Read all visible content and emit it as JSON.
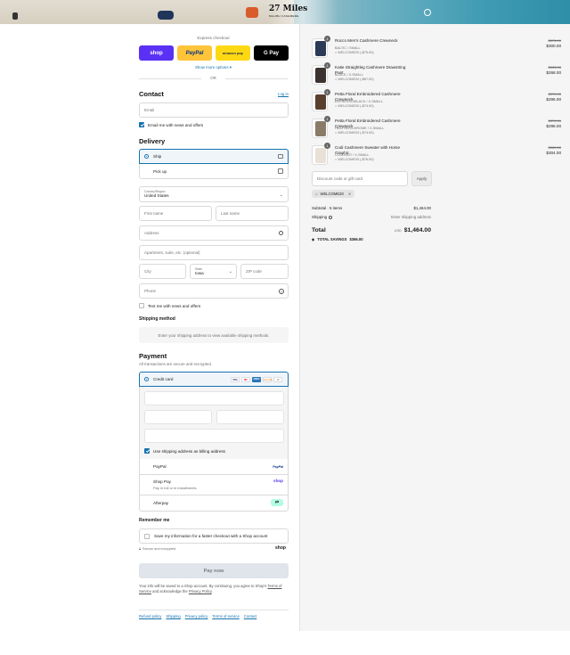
{
  "banner": {
    "brand_name": "27 Miles",
    "brand_tagline": "MALIBU CASHMERE"
  },
  "express": {
    "heading": "Express checkout",
    "shop_label": "shop",
    "paypal_label": "PayPal",
    "amazon_label": "amazon pay",
    "gpay_label": "G Pay",
    "more_options": "Show more options ▾",
    "or": "OR"
  },
  "contact": {
    "heading": "Contact",
    "login": "Log in",
    "email_placeholder": "Email",
    "news_label": "Email me with news and offers"
  },
  "delivery": {
    "heading": "Delivery",
    "ship": "Ship",
    "pickup": "Pick up",
    "country_label": "Country/Region",
    "country_value": "United States",
    "first_name": "First name",
    "last_name": "Last name",
    "address": "Address",
    "apartment": "Apartment, suite, etc. (optional)",
    "city": "City",
    "state_label": "State",
    "state_value": "Iowa",
    "zip": "ZIP code",
    "phone": "Phone",
    "text_label": "Text me with news and offers"
  },
  "shipping": {
    "heading": "Shipping method",
    "note": "Enter your shipping address to view available shipping methods."
  },
  "payment": {
    "heading": "Payment",
    "subtitle": "All transactions are secure and encrypted.",
    "credit_card": "Credit card",
    "more_cards": "+7",
    "billing_label": "Use shipping address as billing address",
    "paypal": "PayPal",
    "shoppay": "Shop Pay",
    "shoppay_sub": "Pay in full or in installments",
    "afterpay": "Afterpay",
    "card_icons": [
      "VISA",
      "MC",
      "AMEX",
      "DISCOVER"
    ]
  },
  "remember": {
    "heading": "Remember me",
    "label": "Save my information for a faster checkout with a Shop account",
    "secure": "Secure and encrypted",
    "shop_logo": "shop"
  },
  "pay_button": "Pay now",
  "legal": {
    "text1": "Your info will be saved to a Shop account. By continuing, you agree to Shop's ",
    "tos": "Terms of Service",
    "text2": " and acknowledge the ",
    "privacy": "Privacy Policy",
    "text3": "."
  },
  "footer": {
    "links": [
      "Refund policy",
      "Shipping",
      "Privacy policy",
      "Terms of service",
      "Contact"
    ]
  },
  "cart": {
    "items": [
      {
        "qty": "1",
        "name": "Rocco Men's Cashmere Crewneck",
        "variant": "BALTIC / SMALL",
        "discount": "WELCOME20 (-$75.00)",
        "old_price": "$375.00",
        "price": "$300.00",
        "color": "#2b3a57"
      },
      {
        "qty": "1",
        "name": "Katie Straightleg Cashmere Drawstring Pant",
        "variant": "BLACK / X-SMALL",
        "discount": "WELCOME20 (-$67.00)",
        "old_price": "$335.00",
        "price": "$268.00",
        "color": "#3a3330"
      },
      {
        "qty": "1",
        "name": "Petta Floral Embroidered Cashmere Crewneck",
        "variant": "ESPRESSO/BLACK / X-SMALL",
        "discount": "WELCOME20 (-$74.00)",
        "old_price": "$370.00",
        "price": "$296.00",
        "color": "#5a3f2e"
      },
      {
        "qty": "1",
        "name": "Petta Floral Embroidered Cashmere Crewneck",
        "variant": "HEATHER/CHROME / X-SMALL",
        "discount": "WELCOME20 (-$74.00)",
        "old_price": "$370.00",
        "price": "$296.00",
        "color": "#8a7a68"
      },
      {
        "qty": "1",
        "name": "Codi Cashmere Sweater with Horse Graphic",
        "variant": "COCONUT / X-SMALL",
        "discount": "WELCOME20 (-$76.00)",
        "old_price": "$380.00",
        "price": "$304.00",
        "color": "#e8e2d6"
      }
    ],
    "discount_placeholder": "Discount code or gift card",
    "apply": "Apply",
    "code_tag": "WELCOME20",
    "subtotal_label": "Subtotal · 5 items",
    "subtotal_value": "$1,464.00",
    "shipping_label": "Shipping",
    "shipping_value": "Enter shipping address",
    "total_label": "Total",
    "currency": "USD",
    "total_value": "$1,464.00",
    "savings_label": "TOTAL SAVINGS",
    "savings_value": "$366.00"
  }
}
